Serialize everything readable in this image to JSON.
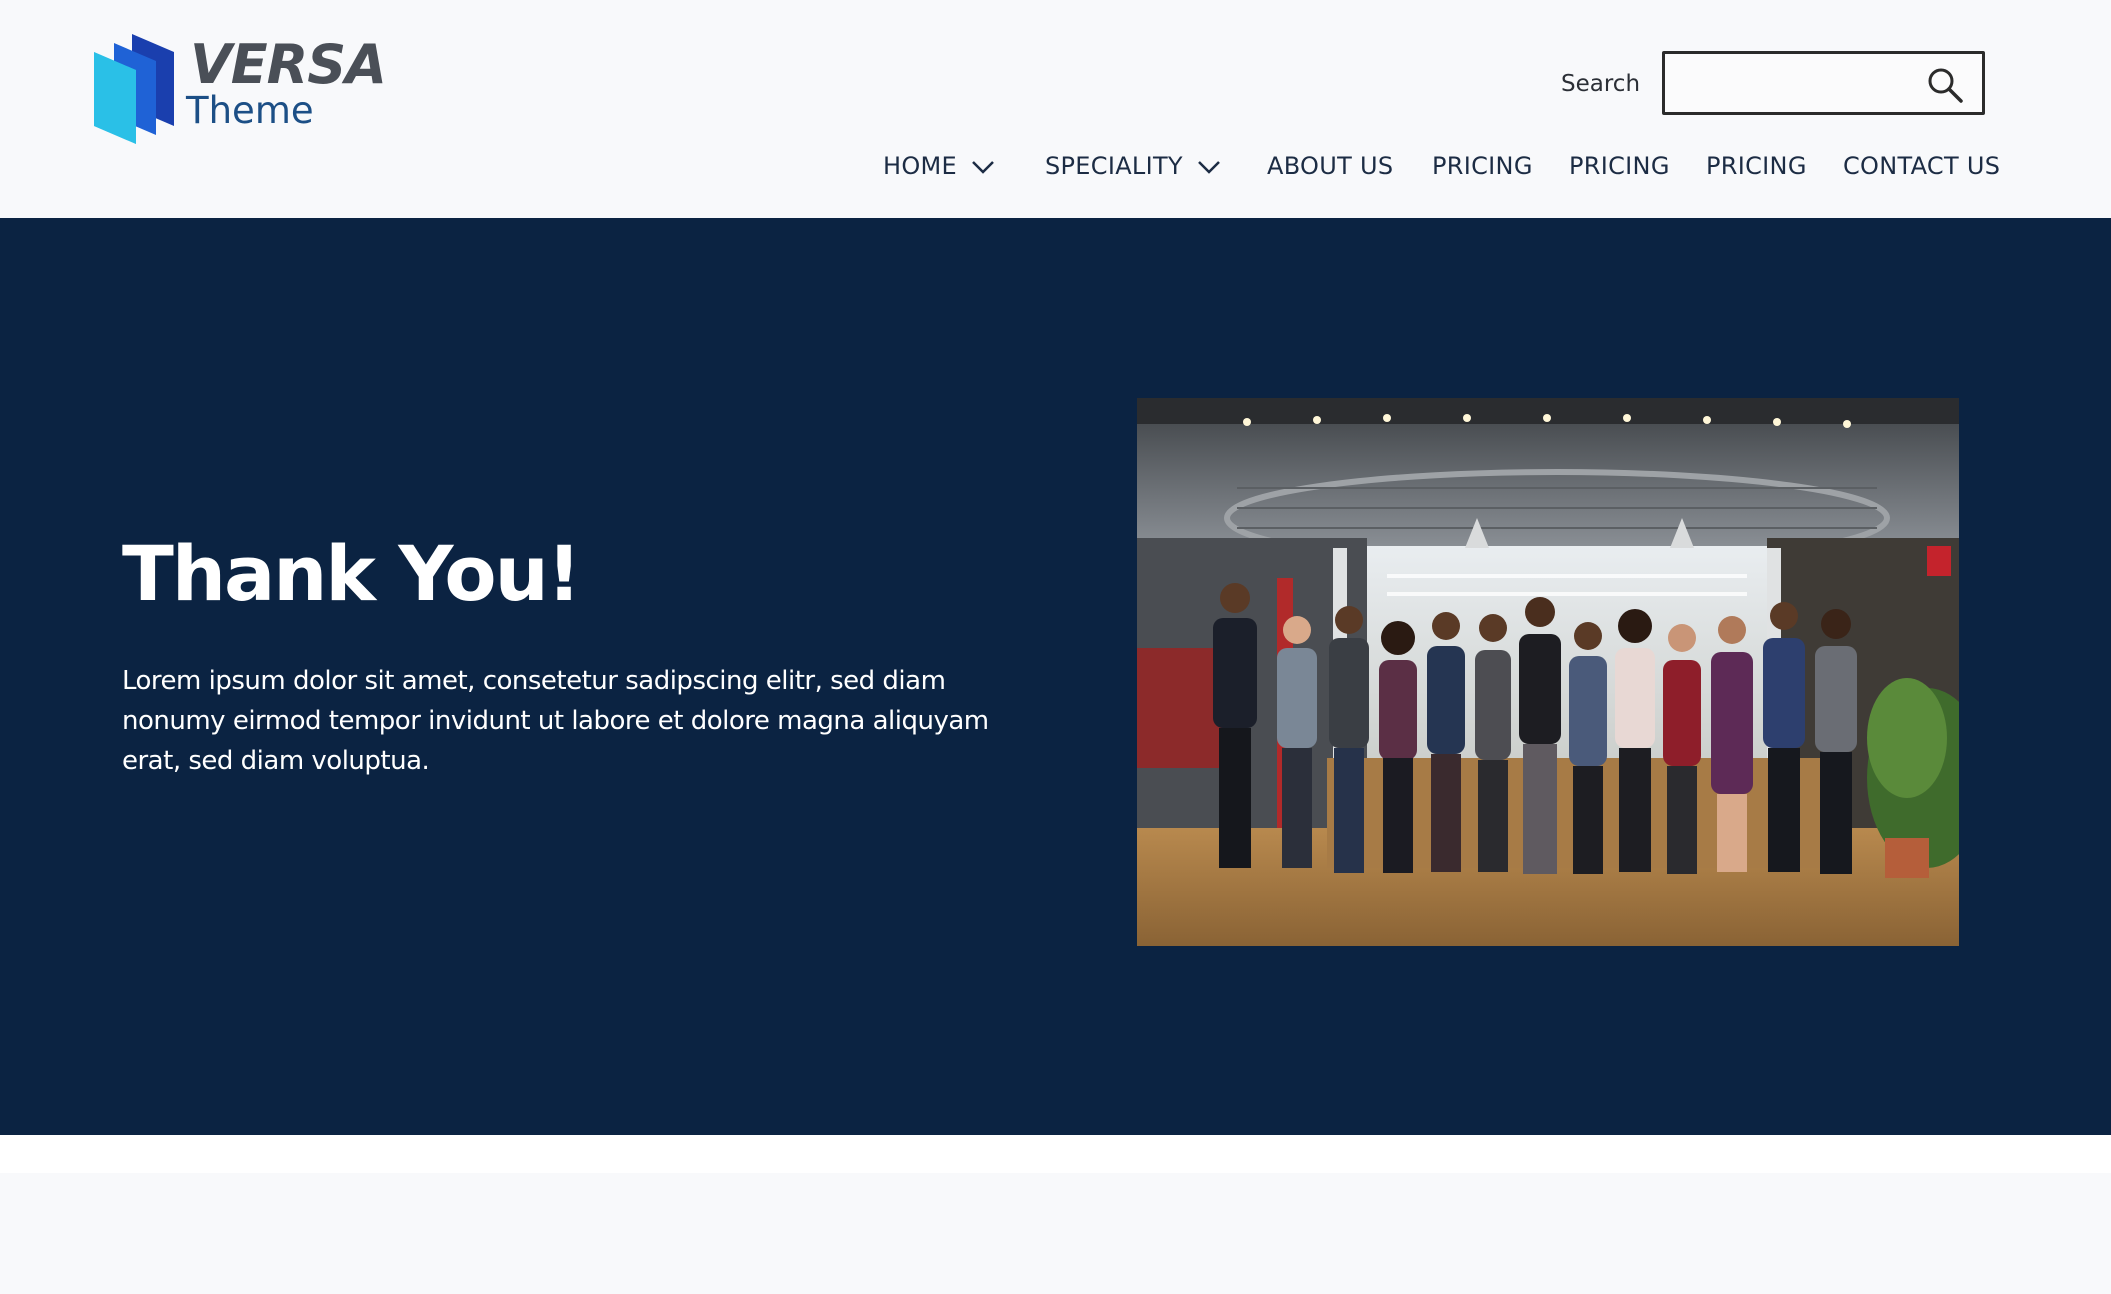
{
  "brand": {
    "name": "VERSA",
    "tagline": "Theme"
  },
  "search": {
    "label": "Search",
    "value": "",
    "placeholder": ""
  },
  "nav": {
    "items": [
      {
        "label": "HOME",
        "has_dropdown": true
      },
      {
        "label": "SPECIALITY",
        "has_dropdown": true
      },
      {
        "label": "ABOUT US",
        "has_dropdown": false
      },
      {
        "label": "PRICING",
        "has_dropdown": false
      },
      {
        "label": "PRICING",
        "has_dropdown": false
      },
      {
        "label": "PRICING",
        "has_dropdown": false
      },
      {
        "label": "CONTACT US",
        "has_dropdown": false
      }
    ]
  },
  "hero": {
    "title": "Thank You!",
    "body": "Lorem ipsum dolor sit amet, consetetur sadipscing elitr, sed diam nonumy eirmod tempor invidunt ut labore et dolore magna aliquyam erat, sed diam voluptua.",
    "image": "team-group-photo-office"
  },
  "colors": {
    "hero_bg": "#0b2342",
    "nav_text": "#1c2c44",
    "brand_text": "#4a4f57",
    "brand_accent": "#1c4f86",
    "page_bg": "#f8f9fb"
  }
}
